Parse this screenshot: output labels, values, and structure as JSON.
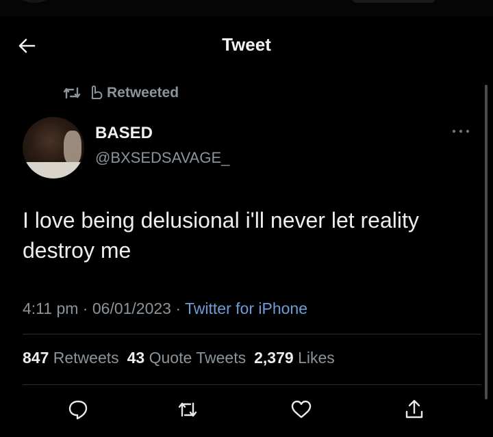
{
  "header": {
    "title": "Tweet"
  },
  "retweet_context": {
    "label": "Retweeted"
  },
  "author": {
    "display_name": "BASED",
    "handle": "@BXSEDSAVAGE_"
  },
  "tweet": {
    "text": "I love being delusional i'll never let reality destroy me",
    "time": "4:11 pm",
    "date": "06/01/2023",
    "separator": " · ",
    "source": "Twitter for iPhone"
  },
  "stats": {
    "retweets_count": "847",
    "retweets_label": "Retweets",
    "quotes_count": "43",
    "quotes_label": "Quote Tweets",
    "likes_count": "2,379",
    "likes_label": "Likes"
  },
  "icons": {
    "back": "arrow-left-icon",
    "retweet": "retweet-icon",
    "retweeted_by": "hand-point-icon",
    "more": "more-horizontal-icon",
    "reply": "reply-icon",
    "like": "heart-icon",
    "share": "share-icon"
  },
  "colors": {
    "background": "#000000",
    "primary_text": "#e7e9ea",
    "secondary_text": "#8b949a",
    "link": "#6f9ed6",
    "divider": "#2a2d30"
  }
}
